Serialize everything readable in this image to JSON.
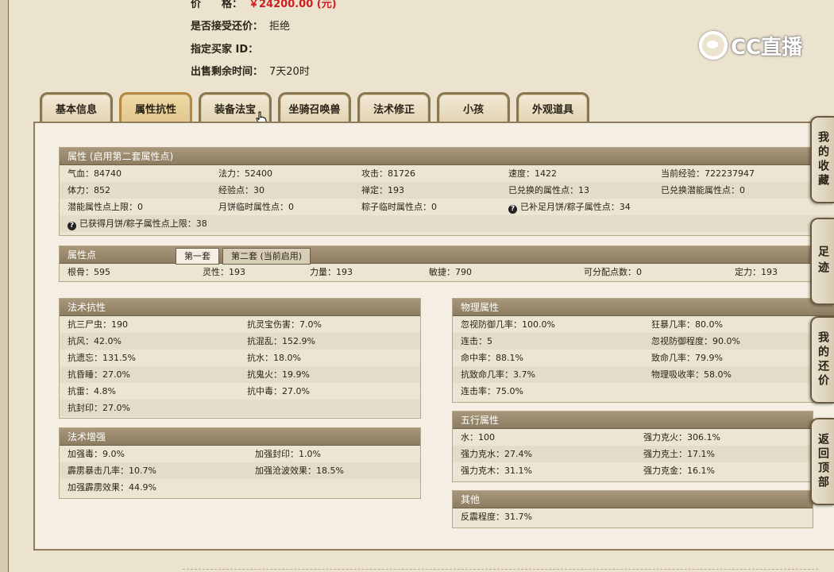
{
  "header": {
    "price_label": "价　　格：",
    "price_value": "￥24200.00 (元)",
    "bargain_label": "是否接受还价：",
    "bargain_value": "拒绝",
    "buyer_label": "指定买家 ID：",
    "remain_label": "出售剩余时间：",
    "remain_value": "7天20时"
  },
  "logo": {
    "text": "CC直播"
  },
  "tabs": [
    "基本信息",
    "属性抗性",
    "装备法宝",
    "坐骑召唤兽",
    "法术修正",
    "小孩",
    "外观道具"
  ],
  "attributes": {
    "title": "属性 (启用第二套属性点)",
    "rows": [
      [
        "气血：84740",
        "法力：52400",
        "攻击：81726",
        "速度：1422",
        "当前经验：722237947"
      ],
      [
        "体力：852",
        "经验点：30",
        "禅定：193",
        "已兑换的属性点：13",
        "已兑换潜能属性点：0"
      ],
      [
        "潜能属性点上限：0",
        "月饼临时属性点：0",
        "粽子临时属性点：0",
        "已补足月饼/粽子属性点：34",
        ""
      ],
      [
        "已获得月饼/粽子属性点上限：38",
        "",
        "",
        "",
        ""
      ]
    ]
  },
  "points": {
    "title": "属性点",
    "subtab1": "第一套",
    "subtab2": "第二套 (当前启用)",
    "values": [
      "根骨：595",
      "灵性：193",
      "力量：193",
      "敏捷：790",
      "可分配点数：0",
      "定力：193"
    ]
  },
  "resist": {
    "title": "法术抗性",
    "rows": [
      [
        "抗三尸虫：190",
        "抗灵宝伤害：7.0%"
      ],
      [
        "抗风：42.0%",
        "抗混乱：152.9%"
      ],
      [
        "抗遗忘：131.5%",
        "抗水：18.0%"
      ],
      [
        "抗昏睡：27.0%",
        "抗鬼火：19.9%"
      ],
      [
        "抗雷：4.8%",
        "抗中毒：27.0%"
      ],
      [
        "抗封印：27.0%",
        ""
      ]
    ]
  },
  "enhance": {
    "title": "法术增强",
    "rows": [
      [
        "加强毒：9.0%",
        "加强封印：1.0%"
      ],
      [
        "霹雳暴击几率：10.7%",
        "加强沧波效果：18.5%"
      ],
      [
        "加强霹雳效果：44.9%",
        ""
      ]
    ]
  },
  "physical": {
    "title": "物理属性",
    "rows": [
      [
        "忽视防御几率：100.0%",
        "狂暴几率：80.0%"
      ],
      [
        "连击：5",
        "忽视防御程度：90.0%"
      ],
      [
        "命中率：88.1%",
        "致命几率：79.9%"
      ],
      [
        "抗致命几率：3.7%",
        "物理吸收率：58.0%"
      ],
      [
        "连击率：75.0%",
        ""
      ]
    ]
  },
  "elements": {
    "title": "五行属性",
    "rows": [
      [
        "水：100",
        "强力克火：306.1%"
      ],
      [
        "强力克水：27.4%",
        "强力克土：17.1%"
      ],
      [
        "强力克木：31.1%",
        "强力克金：16.1%"
      ]
    ]
  },
  "other": {
    "title": "其他",
    "rows": [
      [
        "反震程度：31.7%"
      ]
    ]
  },
  "side_buttons": [
    "我的收藏",
    "足迹",
    "我的还价",
    "返回顶部"
  ]
}
